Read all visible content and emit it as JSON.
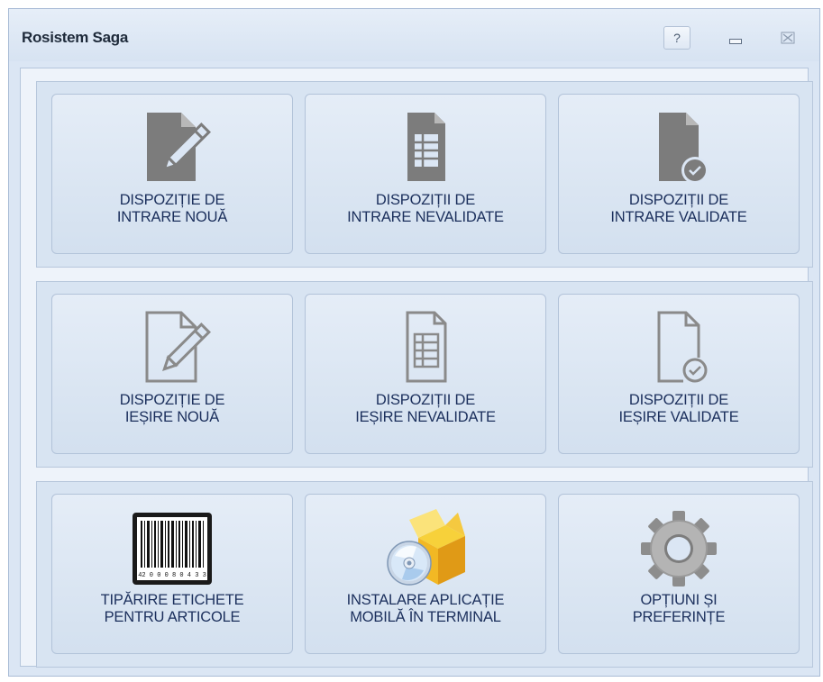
{
  "window": {
    "title": "Rosistem Saga",
    "help_label": "?"
  },
  "groups": [
    {
      "tiles": [
        {
          "line1": "DISPOZIȚIE DE",
          "line2": "INTRARE NOUĂ",
          "icon": "edit-document-icon"
        },
        {
          "line1": "DISPOZIȚII DE",
          "line2": "INTRARE NEVALIDATE",
          "icon": "spreadsheet-document-icon"
        },
        {
          "line1": "DISPOZIȚII DE",
          "line2": "INTRARE VALIDATE",
          "icon": "validated-document-icon"
        }
      ]
    },
    {
      "tiles": [
        {
          "line1": "DISPOZIȚIE DE",
          "line2": "IEȘIRE NOUĂ",
          "icon": "edit-document-outline-icon"
        },
        {
          "line1": "DISPOZIȚII DE",
          "line2": "IEȘIRE NEVALIDATE",
          "icon": "spreadsheet-document-outline-icon"
        },
        {
          "line1": "DISPOZIȚII DE",
          "line2": "IEȘIRE VALIDATE",
          "icon": "validated-document-outline-icon"
        }
      ]
    },
    {
      "tiles": [
        {
          "line1": "TIPĂRIRE ETICHETE",
          "line2": "PENTRU ARTICOLE",
          "icon": "barcode-icon"
        },
        {
          "line1": "INSTALARE APLICAȚIE",
          "line2": "MOBILĂ ÎN TERMINAL",
          "icon": "install-package-icon"
        },
        {
          "line1": "OPȚIUNI ȘI",
          "line2": "PREFERINȚE",
          "icon": "gear-icon"
        }
      ]
    }
  ],
  "barcode_text": "42 0 0 0 8 0 4 3 3",
  "colors": {
    "window_bg": "#dbe6f4",
    "tile_text": "#1b2f5c",
    "icon_dark": "#7c7c7c",
    "icon_outline": "#8a8a8a"
  }
}
